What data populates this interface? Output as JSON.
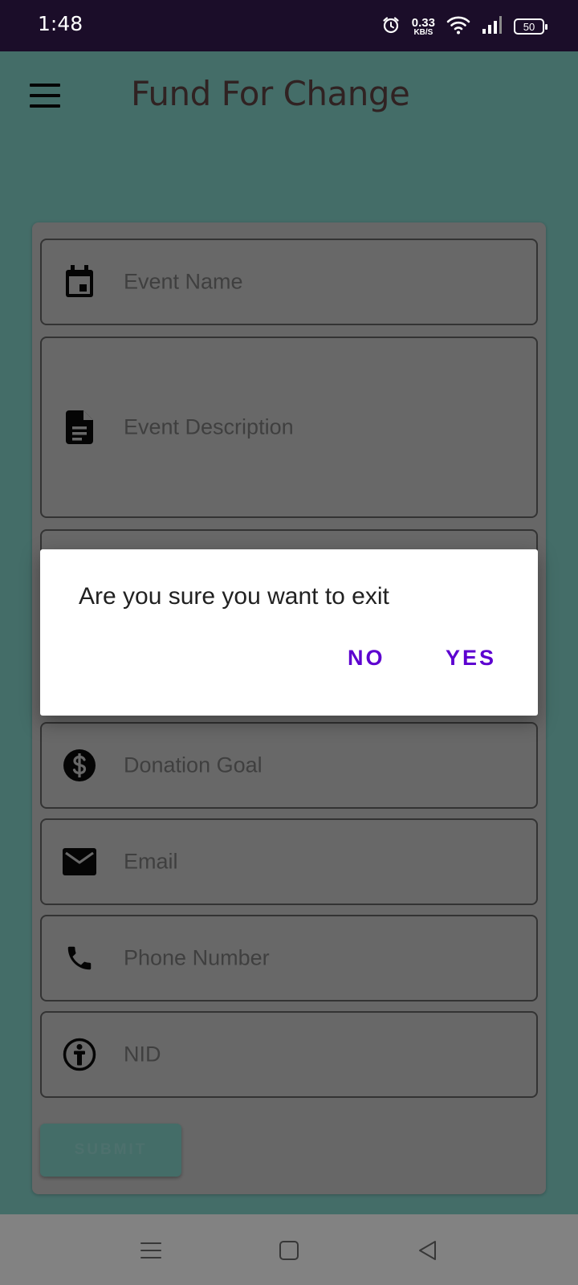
{
  "status_bar": {
    "time": "1:48",
    "net_speed_value": "0.33",
    "net_speed_unit": "KB/S",
    "battery": "50",
    "icons": [
      "alarm-icon",
      "wifi-icon",
      "signal-icon",
      "battery-icon"
    ]
  },
  "app_bar": {
    "title": "Fund For Change",
    "menu_icon": "menu-icon"
  },
  "form": {
    "fields": [
      {
        "icon": "calendar-icon",
        "placeholder": "Event Name"
      },
      {
        "icon": "description-icon",
        "placeholder": "Event Description"
      },
      {
        "icon": "",
        "placeholder": ""
      },
      {
        "icon": "dollar-icon",
        "placeholder": "Donation Goal"
      },
      {
        "icon": "email-icon",
        "placeholder": "Email"
      },
      {
        "icon": "phone-icon",
        "placeholder": "Phone Number"
      },
      {
        "icon": "person-id-icon",
        "placeholder": "NID"
      }
    ],
    "submit_label": "SUBMIT"
  },
  "dialog": {
    "message": "Are you sure you want to exit",
    "no_label": "NO",
    "yes_label": "YES"
  },
  "nav_bar": {
    "icons": [
      "recents-icon",
      "home-icon",
      "back-icon"
    ]
  },
  "colors": {
    "app_background": "#7fc9c1",
    "status_bar": "#1b0d29",
    "dialog_button": "#5d00d0",
    "title": "#5a4040"
  }
}
